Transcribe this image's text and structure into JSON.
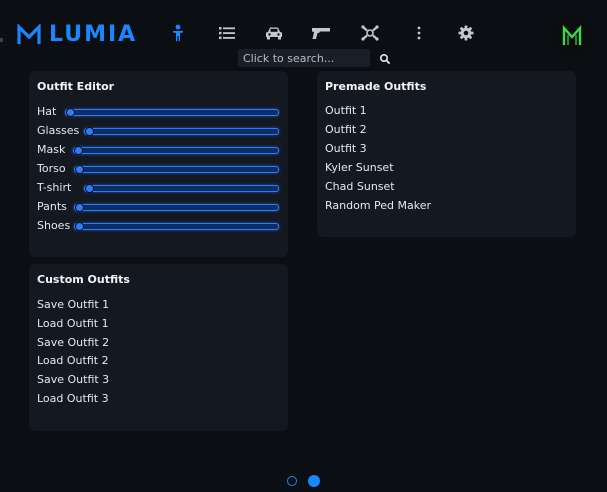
{
  "app": {
    "title": "LUMIA"
  },
  "search": {
    "placeholder": "Click to search..."
  },
  "nav": {
    "icons": [
      "person-icon",
      "list-icon",
      "car-icon",
      "gun-icon",
      "bone-icon",
      "more-vertical-icon",
      "gear-icon"
    ],
    "active_index": 0
  },
  "colors": {
    "accent": "#1b87ff",
    "panel": "#141821",
    "background": "#0b0e13",
    "avatar_logo": "#3ddc4a"
  },
  "outfit_editor": {
    "title": "Outfit Editor",
    "sliders": [
      {
        "label": "Hat",
        "value": 0.0
      },
      {
        "label": "Glasses",
        "value": 0.0
      },
      {
        "label": "Mask",
        "value": 0.0
      },
      {
        "label": "Torso",
        "value": 0.0
      },
      {
        "label": "T-shirt",
        "value": 0.0
      },
      {
        "label": "Pants",
        "value": 0.0
      },
      {
        "label": "Shoes",
        "value": 0.0
      }
    ]
  },
  "custom_outfits": {
    "title": "Custom Outfits",
    "items": [
      "Save Outfit 1",
      "Load Outfit 1",
      "Save Outfit 2",
      "Load Outfit 2",
      "Save Outfit 3",
      "Load Outfit 3"
    ]
  },
  "premade_outfits": {
    "title": "Premade Outfits",
    "items": [
      "Outfit 1",
      "Outfit 2",
      "Outfit 3",
      "Kyler Sunset",
      "Chad Sunset",
      "Random Ped Maker"
    ]
  },
  "pagination": {
    "pages": 2,
    "current": 2
  }
}
